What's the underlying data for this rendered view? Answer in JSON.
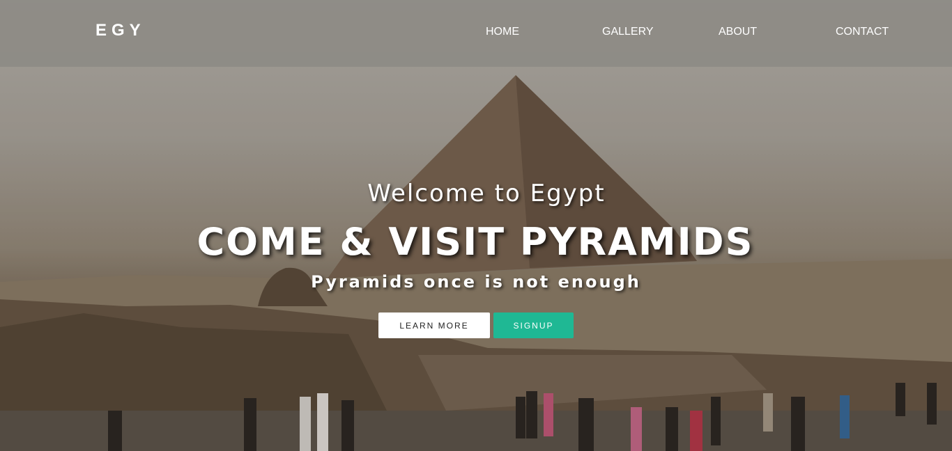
{
  "brand": {
    "name": "EGY"
  },
  "nav": {
    "home": "HOME",
    "gallery": "GALLERY",
    "about": "ABOUT",
    "contact": "CONTACT"
  },
  "hero": {
    "welcome": "Welcome to Egypt",
    "headline": "COME & VISIT PYRAMIDS",
    "subline": "Pyramids once is not enough",
    "learn_more": "LEARN MORE",
    "signup": "SIGNUP"
  },
  "colors": {
    "accent": "#1fb894",
    "navbar": "#8c8984",
    "text": "#ffffff"
  }
}
